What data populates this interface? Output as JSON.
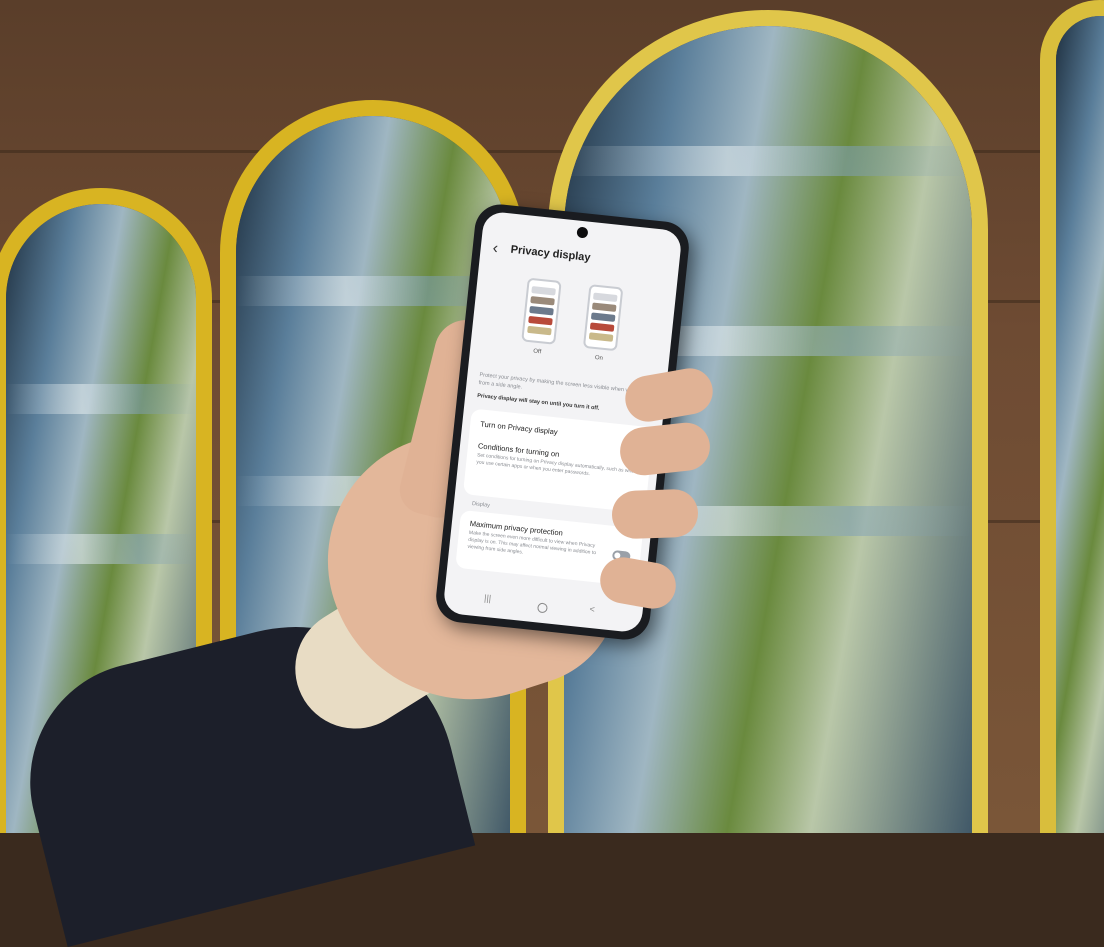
{
  "screen": {
    "title": "Privacy display",
    "back_icon": "chevron-left-icon",
    "illustration": {
      "off_label": "Off",
      "on_label": "On"
    },
    "description": "Protect your privacy by making the screen less visible when viewed from a side angle.",
    "note": "Privacy display will stay on until you turn it off.",
    "settings": [
      {
        "title": "Turn on Privacy display",
        "toggle": "on"
      },
      {
        "title": "Conditions for turning on",
        "subtitle": "Set conditions for turning on Privacy display automatically, such as when you use certain apps or when you enter passwords."
      }
    ],
    "section_label": "Display",
    "display_settings": [
      {
        "title": "Maximum privacy protection",
        "subtitle": "Make the screen even more difficult to view when Privacy display is on. This may affect normal viewing in addition to viewing from side angles.",
        "toggle": "off"
      }
    ],
    "nav": {
      "recents_glyph": "|||",
      "back_glyph": "<"
    },
    "accent_color": "#3e6fd8"
  }
}
